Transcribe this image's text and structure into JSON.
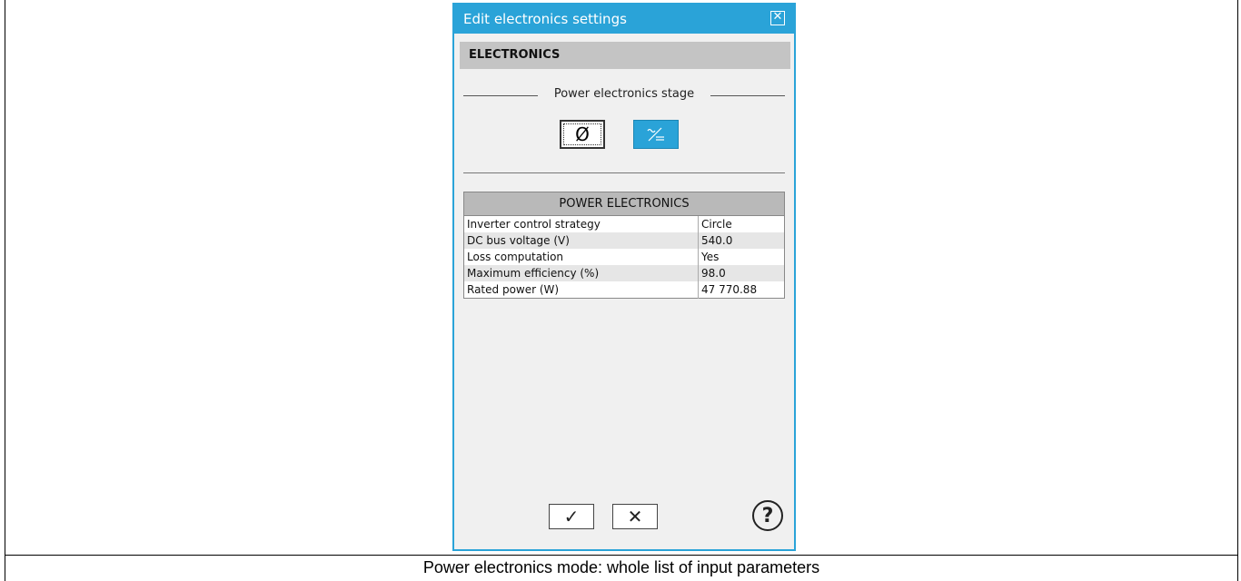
{
  "dialog": {
    "title": "Edit electronics settings",
    "close_glyph": "☒",
    "accent_color": "#2aa3d8"
  },
  "section": {
    "title": "ELECTRONICS"
  },
  "stage": {
    "label": "Power electronics stage",
    "options": [
      {
        "icon": "none-icon",
        "glyph": "Ø"
      },
      {
        "icon": "ac-dc-icon",
        "glyph": "⁓⁄₌",
        "selected": true
      }
    ]
  },
  "table": {
    "header": "POWER ELECTRONICS",
    "rows": [
      {
        "label": "Inverter control strategy",
        "value": "Circle"
      },
      {
        "label": "DC bus voltage (V)",
        "value": "540.0"
      },
      {
        "label": "Loss computation",
        "value": "Yes"
      },
      {
        "label": "Maximum efficiency (%)",
        "value": "98.0"
      },
      {
        "label": "Rated power (W)",
        "value": "47 770.88"
      }
    ]
  },
  "buttons": {
    "ok_glyph": "✓",
    "cancel_glyph": "✕",
    "help_glyph": "?"
  },
  "caption": "Power electronics mode: whole list of input parameters"
}
